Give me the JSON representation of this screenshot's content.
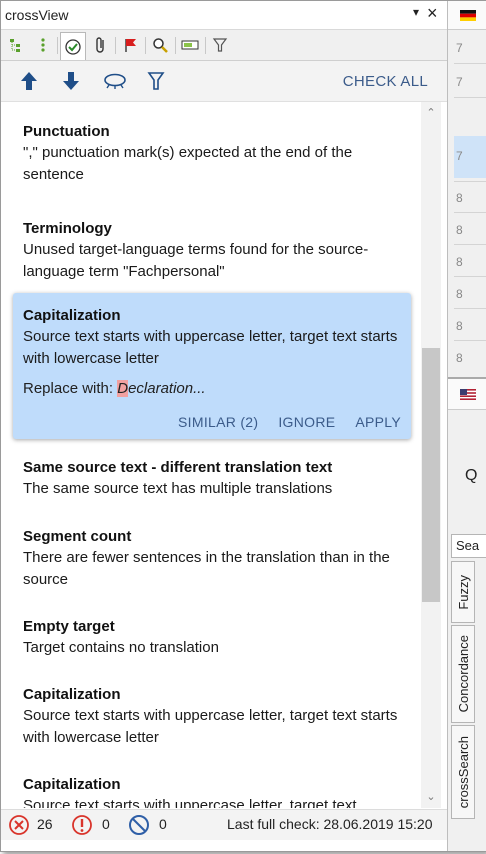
{
  "window": {
    "title": "crossView",
    "pin_icon": "pin-icon",
    "close_icon": "close-icon"
  },
  "tabs": [
    {
      "icon": "structure-tree-icon"
    },
    {
      "icon": "dotted-list-icon"
    },
    {
      "icon": "qa-check-icon",
      "active": true
    },
    {
      "icon": "paperclip-icon"
    },
    {
      "icon": "flag-icon"
    },
    {
      "icon": "magnifier-icon"
    },
    {
      "icon": "ruler-icon"
    },
    {
      "icon": "filter-icon"
    }
  ],
  "toolbar": {
    "check_all_label": "CHECK ALL"
  },
  "items": [
    {
      "title": "Punctuation",
      "description": "\",\" punctuation mark(s) expected at the end of the sentence"
    },
    {
      "title": "Terminology",
      "description": "Unused target-language terms found for the source-language term \"Fachpersonal\""
    },
    {
      "title": "Capitalization",
      "description": "Source text starts with uppercase letter, target text starts with lowercase letter",
      "selected": true,
      "replace_label": "Replace with:",
      "replace_highlight": "D",
      "replace_value": "eclaration...",
      "actions": {
        "similar": "SIMILAR (2)",
        "ignore": "IGNORE",
        "apply": "APPLY"
      }
    },
    {
      "title": "Same source text - different translation text",
      "description": "The same source text has multiple translations"
    },
    {
      "title": "Segment count",
      "description": "There are fewer sentences in the translation than in the source"
    },
    {
      "title": "Empty target",
      "description": "Target contains no translation"
    },
    {
      "title": "Capitalization",
      "description": "Source text starts with uppercase letter, target text starts with lowercase letter"
    },
    {
      "title": "Capitalization",
      "description": "Source text starts with uppercase letter, target text"
    }
  ],
  "status": {
    "errors": "26",
    "warnings": "0",
    "ignored": "0",
    "last_check": "Last full check: 28.06.2019 15:20"
  },
  "side_panel": {
    "row_numbers": [
      "7",
      "7",
      "7",
      "8",
      "8",
      "8",
      "8",
      "8",
      "8"
    ],
    "search_tab": "Sea",
    "vertical_tabs": [
      "Fuzzy",
      "Concordance",
      "crossSearch"
    ],
    "q_label": "Q"
  },
  "colors": {
    "accent": "#3b5b8a",
    "selection": "#bfdcfb",
    "error": "#d9342b",
    "ignored": "#2f5fa7"
  }
}
